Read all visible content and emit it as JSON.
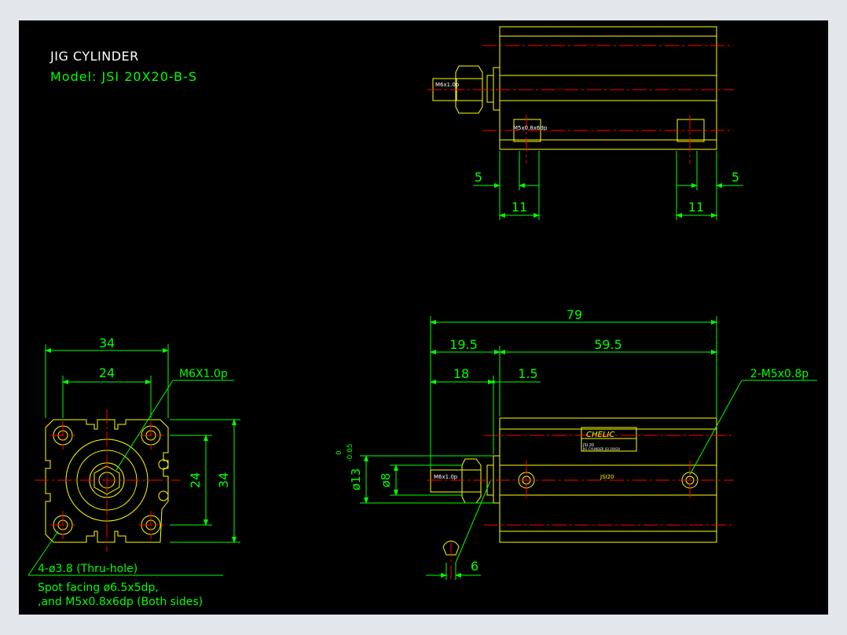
{
  "title": "JIG CYLINDER",
  "model": "Model: JSI 20X20-B-S",
  "colors": {
    "background": "#000000",
    "frame": "#e3e6ea",
    "outline": "#ffff00",
    "dimension": "#00ff00",
    "centerline": "#ff0000",
    "text_white": "#ffffff"
  },
  "top_view": {
    "thread_label": "M6x1.0p",
    "port_label": "M5x0.8x6dp",
    "dim_left_offset": "5",
    "dim_right_offset": "5",
    "dim_left_width": "11",
    "dim_right_width": "11"
  },
  "end_view": {
    "dim_width_outer": "34",
    "dim_width_inner": "24",
    "dim_height_inner": "24",
    "dim_height_outer": "34",
    "rod_thread": "M6X1.0p",
    "hole_note": "4-ø3.8 (Thru-hole)",
    "spot_note_1": "Spot facing ø6.5x5dp,",
    "spot_note_2": ",and M5x0.8x6dp (Both sides)"
  },
  "side_view": {
    "dim_total": "79",
    "dim_rod": "19.5",
    "dim_body": "59.5",
    "dim_rod_thread": "18",
    "dim_gap": "1.5",
    "port_label": "2-M5x0.8p",
    "dim_rod_dia": "ø13",
    "tol_upper": "0",
    "tol_lower": "-0.05",
    "dim_thread_dia": "ø8",
    "dim_wrench": "6",
    "thread_label": "M6x1.0p",
    "brand": "CHELIC",
    "model_text": "JSI20",
    "plate_line_1": "JSI 20",
    "plate_line_2": "JIG CYLINDER JSI 20X20"
  }
}
